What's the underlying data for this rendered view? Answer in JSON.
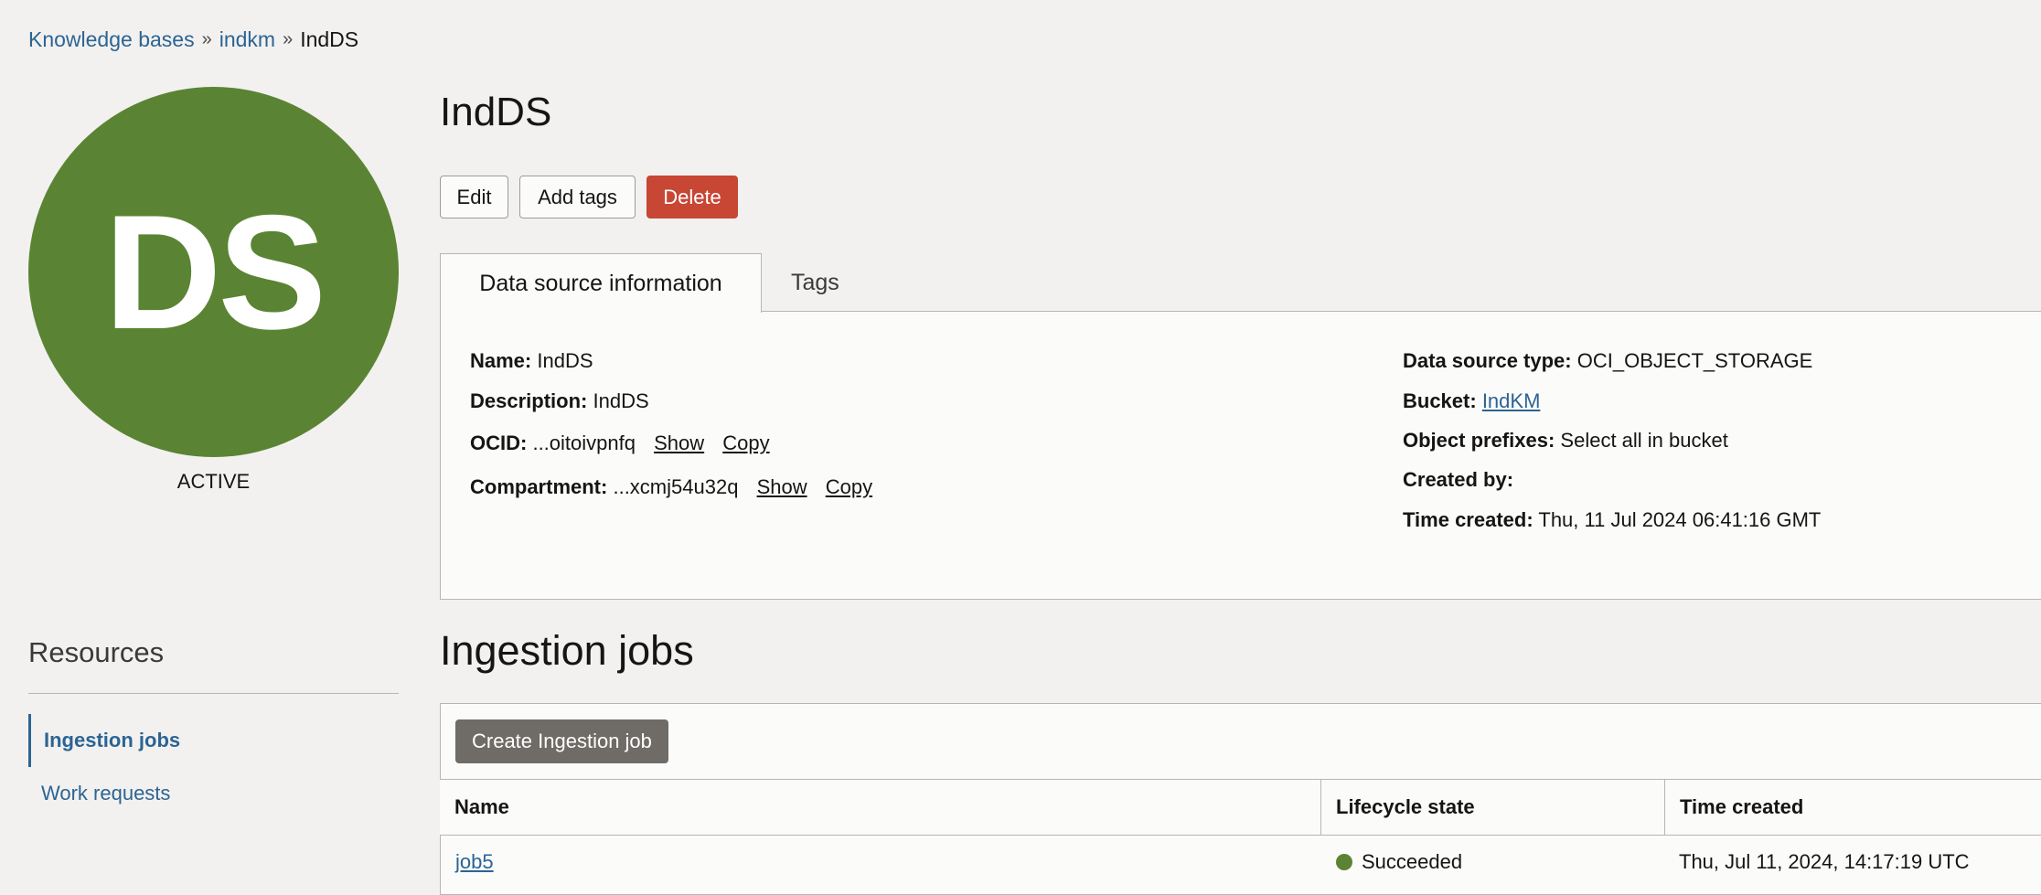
{
  "breadcrumb": {
    "items": [
      "Knowledge bases",
      "indkm",
      "IndDS"
    ],
    "separator": "»"
  },
  "avatar": {
    "initials": "DS",
    "color": "#5a8433"
  },
  "status": "ACTIVE",
  "resources": {
    "title": "Resources",
    "items": [
      {
        "label": "Ingestion jobs",
        "active": true
      },
      {
        "label": "Work requests",
        "active": false
      }
    ]
  },
  "page_title": "IndDS",
  "actions": {
    "edit": "Edit",
    "add_tags": "Add tags",
    "delete": "Delete",
    "delete_color": "#c74634"
  },
  "tabs": [
    "Data source information",
    "Tags"
  ],
  "info": {
    "name_label": "Name:",
    "name_value": "IndDS",
    "description_label": "Description:",
    "description_value": "IndDS",
    "ocid_label": "OCID:",
    "ocid_value": "...oitoivpnfq",
    "compartment_label": "Compartment:",
    "compartment_value": "...xcmj54u32q",
    "show": "Show",
    "copy": "Copy",
    "type_label": "Data source type:",
    "type_value": "OCI_OBJECT_STORAGE",
    "bucket_label": "Bucket:",
    "bucket_value": "IndKM",
    "prefixes_label": "Object prefixes:",
    "prefixes_value": "Select all in bucket",
    "created_by_label": "Created by:",
    "created_by_value": "",
    "time_created_label": "Time created:",
    "time_created_value": "Thu, 11 Jul 2024 06:41:16 GMT"
  },
  "ingestion": {
    "title": "Ingestion jobs",
    "create_button": "Create Ingestion job",
    "columns": [
      "Name",
      "Lifecycle state",
      "Time created"
    ],
    "rows": [
      {
        "name": "job5",
        "state": "Succeeded",
        "time_created": "Thu, Jul 11, 2024, 14:17:19 UTC"
      }
    ],
    "success_color": "#5a8433"
  }
}
